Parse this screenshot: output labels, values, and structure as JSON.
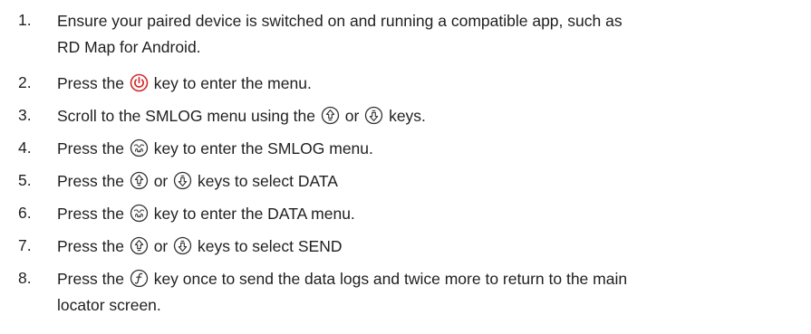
{
  "steps": [
    {
      "num": "1.",
      "line1": "Ensure your paired device is switched on and running a compatible app, such as",
      "line2": "RD Map for Android."
    },
    {
      "num": "2.",
      "before": "Press the",
      "icon": "power-key-icon",
      "after": "key to enter the menu."
    },
    {
      "num": "3.",
      "before": "Scroll to the SMLOG menu using the",
      "icon1": "up-arrow-key-icon",
      "mid": "or",
      "icon2": "down-arrow-key-icon",
      "after": "keys."
    },
    {
      "num": "4.",
      "before": "Press the",
      "icon": "antenna-key-icon",
      "after": "key to enter the SMLOG menu."
    },
    {
      "num": "5.",
      "before": "Press the",
      "icon1": "up-arrow-key-icon",
      "mid": "or",
      "icon2": "down-arrow-key-icon",
      "after": "keys to select DATA"
    },
    {
      "num": "6.",
      "before": "Press the",
      "icon": "antenna-key-icon",
      "after": "key to enter the DATA menu."
    },
    {
      "num": "7.",
      "before": "Press the",
      "icon1": "up-arrow-key-icon",
      "mid": "or",
      "icon2": "down-arrow-key-icon",
      "after": "keys to select SEND"
    },
    {
      "num": "8.",
      "before": "Press the",
      "icon": "frequency-key-icon",
      "after": "key once to send the data logs and twice more to return to the main",
      "line2": "locator screen."
    }
  ],
  "colors": {
    "text": "#1f1f1f",
    "power_icon": "#d42a2a",
    "icon_stroke": "#333333"
  }
}
